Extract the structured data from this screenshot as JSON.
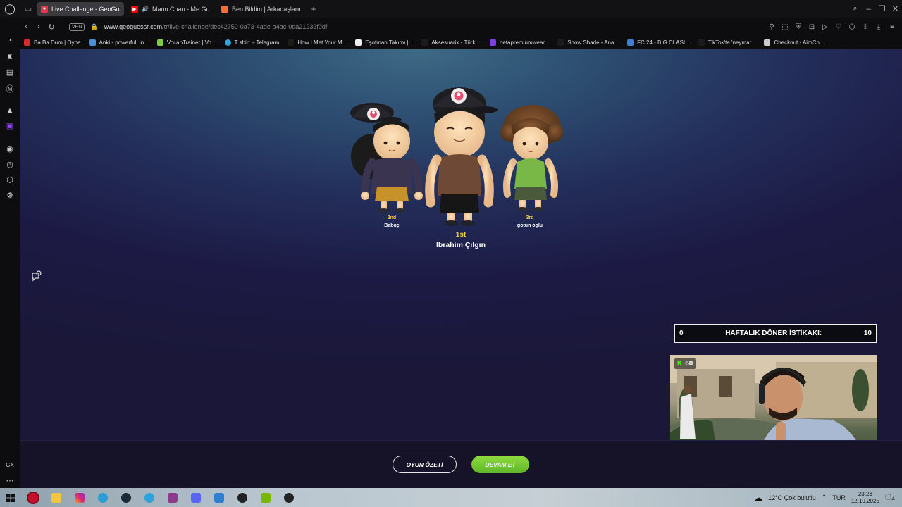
{
  "browser": {
    "tabs": [
      {
        "label": "Live Challenge - GeoGues",
        "favicon_color": "#e8364f",
        "active": true
      },
      {
        "label": "Manu Chao - Me Gusta",
        "favicon_color": "#ff0000",
        "active": false
      },
      {
        "label": "Ben Bildim | Arkadaşlarınız",
        "favicon_color": "#ff6b35",
        "active": false
      }
    ],
    "url_domain": "www.geoguessr.com",
    "url_path": "/tr/live-challenge/dec42759-0a73-4ade-a4ac-0da21233f0df",
    "vpn_label": "VPN",
    "sidebar_bottom_label": "GX"
  },
  "bookmarks": [
    {
      "label": "Ba Ba Dum | Oyna",
      "color": "#d62b2b"
    },
    {
      "label": "Anki - powerful, in...",
      "color": "#4a90d9"
    },
    {
      "label": "VocabTrainer | Vo...",
      "color": "#7ccd42"
    },
    {
      "label": "T shirt – Telegram",
      "color": "#2aa3de"
    },
    {
      "label": "How I Met Your M...",
      "color": "#1b1b1b"
    },
    {
      "label": "Eşofman Takımı |...",
      "color": "#eeeeee"
    },
    {
      "label": "Aksesuarix - Türki...",
      "color": "#1b1b1b"
    },
    {
      "label": "betapremiumwear...",
      "color": "#7b3fe4"
    },
    {
      "label": "Snow Shade - Ana...",
      "color": "#1b1b1b"
    },
    {
      "label": "FC 24 - BIG CLASI...",
      "color": "#3d7fd6"
    },
    {
      "label": "TikTok'ta 'neymar...",
      "color": "#1b1b1b"
    },
    {
      "label": "Checkout - AimCh...",
      "color": "#cccccc"
    }
  ],
  "podium": {
    "first": {
      "place": "1st",
      "name": "Ibrahim Çılgın"
    },
    "second": {
      "place": "2nd",
      "name": "Baboç"
    },
    "third": {
      "place": "3rd",
      "name": "gotun oglu"
    }
  },
  "buttons": {
    "summary": "OYUN ÖZETİ",
    "continue": "DEVAM ET"
  },
  "weekly_widget": {
    "left_value": "0",
    "title": "HAFTALIK DÖNER İSTİKAKI:",
    "right_value": "10"
  },
  "webcam": {
    "viewer_count": "60",
    "platform_letter": "K"
  },
  "taskbar": {
    "weather": "12°C  Çok bulutlu",
    "language": "TUR",
    "time": "23:23",
    "date": "12.10.2025",
    "notifications": "4"
  }
}
